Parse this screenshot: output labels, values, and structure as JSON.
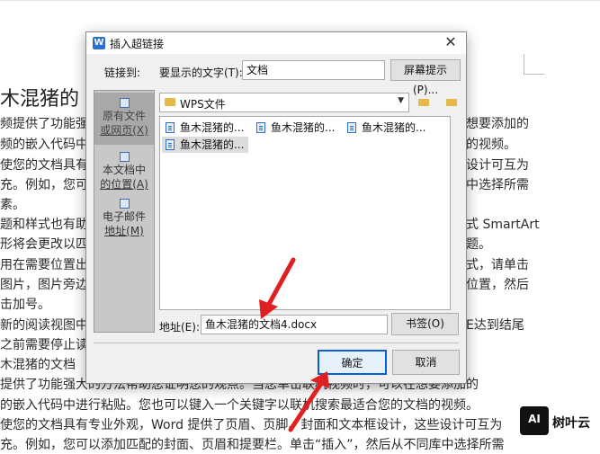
{
  "document": {
    "title_fragment": "木混猪的",
    "lines": [
      {
        "left": "频提供了功能强",
        "right": "想要添加的"
      },
      {
        "left": "频的嵌入代码中",
        "right": "的视频。"
      },
      {
        "left": "使您的文档具有",
        "right": "设计可互为"
      },
      {
        "left": "充。例如，您可",
        "right": "中选择所需"
      },
      {
        "left": "素。",
        "right": ""
      },
      {
        "left": "题和样式也有助",
        "right": "式 SmartArt"
      },
      {
        "left": "形将会更改以匹",
        "right": "题。"
      },
      {
        "left": "用在需要位置出",
        "right": "式，请单击"
      },
      {
        "left": "图片，图片旁边",
        "right": "位置，然后"
      },
      {
        "left": "击加号。",
        "right": ""
      },
      {
        "left": "新的阅读视图中",
        "right": "E达到结尾"
      },
      {
        "left": "之前需要停止读",
        "right": ""
      }
    ],
    "bottom_lines": [
      "木混猪的文档",
      "提供了功能强大的方法帮助您证明您的观点。当您单击联机视频时，可以在想要添加的",
      "的嵌入代码中进行粘贴。您也可以键入一个关键字以联机搜索最适合您的文档的视频。",
      "使您的文档具有专业外观，Word 提供了页眉、页脚、封面和文本框设计，这些设计可互为",
      "充。例如，您可以添加匹配的封面、页眉和提要栏。单击“插入”，然后从不同库中选择所需"
    ]
  },
  "dialog": {
    "title": "插入超链接",
    "close_glyph": "✕",
    "link_to_label": "链接到:",
    "display_text_label": "要显示的文字(T):",
    "display_text_value": "文档",
    "screen_tip_label": "屏幕提示(P)...",
    "left_panel": [
      {
        "label_line1": "原有文件",
        "label_line2": "或网页(X)",
        "selected": true
      },
      {
        "label_line1": "本文档中",
        "label_line2": "的位置(A)",
        "selected": false
      },
      {
        "label_line1": "电子邮件",
        "label_line2": "地址(M)",
        "selected": false
      }
    ],
    "folder": "WPS文件",
    "files": [
      "鱼木混猪的...",
      "鱼木混猪的...",
      "鱼木混猪的...",
      "鱼木混猪的..."
    ],
    "address_label": "地址(E):",
    "address_value": "鱼木混猪的文档4.docx",
    "bookmark_label": "书签(O)",
    "ok_label": "确定",
    "cancel_label": "取消"
  },
  "watermark": {
    "brand": "树叶云",
    "logo_text": "AI"
  },
  "colors": {
    "arrow": "#e02020",
    "selection": "#dcdcdc",
    "panel": "#c8c8c8"
  }
}
